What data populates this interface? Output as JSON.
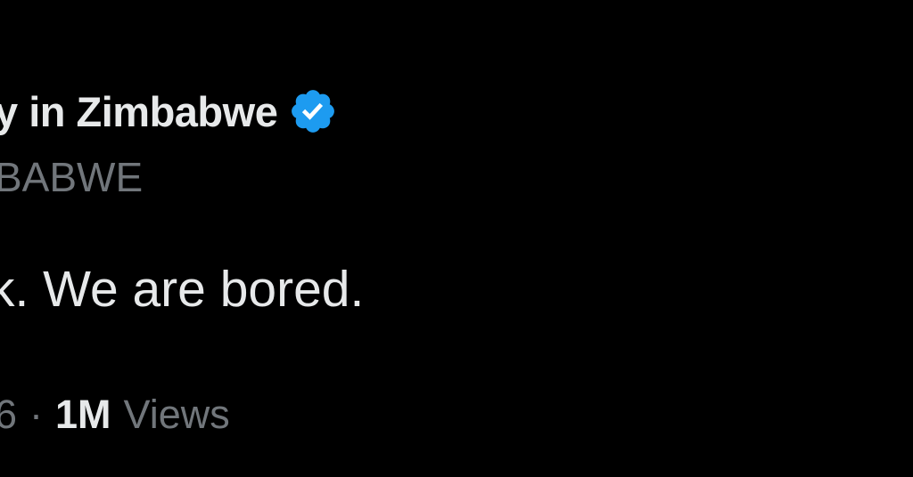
{
  "tweet": {
    "display_name": "y in Zimbabwe",
    "handle": "BABWE",
    "text": "k. We are bored.",
    "timestamp_fragment": "6",
    "separator": "·",
    "views_count": "1M",
    "views_label": "Views"
  },
  "colors": {
    "background": "#000000",
    "primary_text": "#e7e9ea",
    "secondary_text": "#71767b",
    "verified_blue": "#1d9bf0"
  },
  "icons": {
    "verified": "verified-badge-icon"
  }
}
